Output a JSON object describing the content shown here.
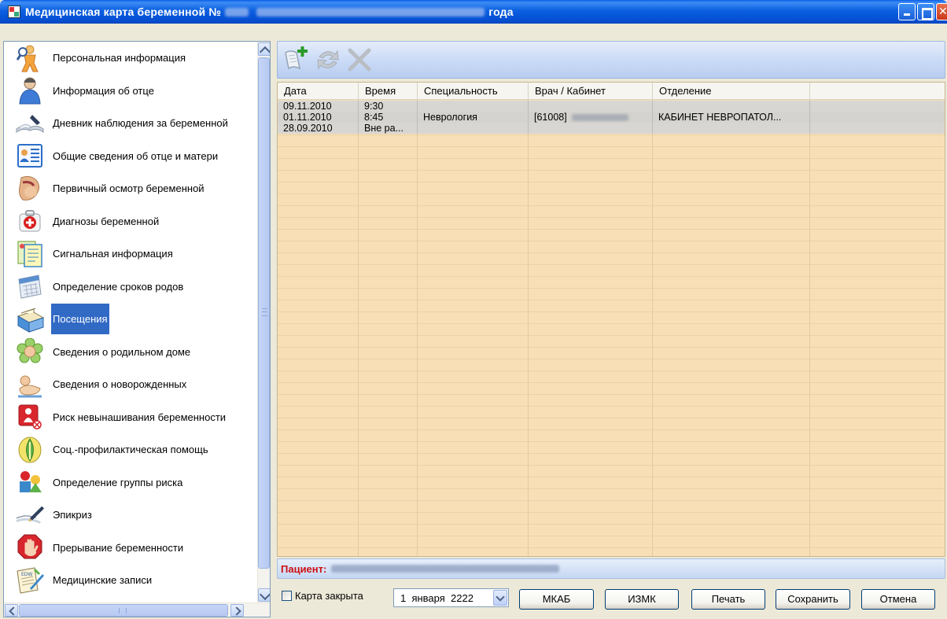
{
  "window": {
    "title_prefix": "Медицинская карта беременной №",
    "title_suffix": "года"
  },
  "sidebar": {
    "items": [
      {
        "label": "Персональная информация",
        "icon": "person-info-icon"
      },
      {
        "label": "Информация об отце",
        "icon": "father-icon"
      },
      {
        "label": "Дневник наблюдения за беременной",
        "icon": "diary-icon"
      },
      {
        "label": "Общие сведения об отце и матери",
        "icon": "parents-card-icon"
      },
      {
        "label": "Первичный осмотр беременной",
        "icon": "pregnant-exam-icon"
      },
      {
        "label": "Диагнозы беременной",
        "icon": "medkit-icon"
      },
      {
        "label": "Сигнальная информация",
        "icon": "signal-info-icon"
      },
      {
        "label": "Определение сроков родов",
        "icon": "calendar-icon"
      },
      {
        "label": "Посещения",
        "icon": "card-file-icon",
        "selected": true
      },
      {
        "label": "Сведения о родильном доме",
        "icon": "baby-flower-icon"
      },
      {
        "label": "Сведения о новорожденных",
        "icon": "newborn-icon"
      },
      {
        "label": "Риск невынашивания беременности",
        "icon": "risk-icon"
      },
      {
        "label": "Соц.-профилактическая помощь",
        "icon": "social-help-icon"
      },
      {
        "label": "Определение группы риска",
        "icon": "risk-group-icon"
      },
      {
        "label": "Эпикриз",
        "icon": "pen-icon"
      },
      {
        "label": "Прерывание беременности",
        "icon": "stop-hand-icon"
      },
      {
        "label": "Медицинские записи",
        "icon": "med-records-icon"
      }
    ]
  },
  "toolbar": {
    "buttons": [
      {
        "name": "add-visit-button",
        "icon": "add-document-icon"
      },
      {
        "name": "refresh-button",
        "icon": "refresh-icon"
      },
      {
        "name": "delete-button",
        "icon": "delete-x-icon"
      }
    ]
  },
  "visits": {
    "columns": [
      "Дата",
      "Время",
      "Специальность",
      "Врач / Кабинет",
      "Отделение"
    ],
    "rows": [
      {
        "date": "09.11.2010",
        "time": "9:30",
        "specialty": "",
        "doctor": "",
        "department": ""
      },
      {
        "date": "01.11.2010",
        "time": "8:45",
        "specialty": "Неврология",
        "doctor": "[61008]",
        "department": "КАБИНЕТ НЕВРОПАТОЛ..."
      },
      {
        "date": "28.09.2010",
        "time": "Вне ра...",
        "specialty": "",
        "doctor": "",
        "department": ""
      }
    ]
  },
  "patient": {
    "label": "Пациент:"
  },
  "footer": {
    "closed_label": "Карта закрыта",
    "closed_checked": false,
    "date_value": "1  января  2222",
    "mkab_label": "МКАБ",
    "izmk_label": "ИЗМК",
    "print_label": "Печать",
    "save_label": "Сохранить",
    "cancel_label": "Отмена"
  },
  "colors": {
    "title_bar": "#0551d6",
    "grid_background": "#f8dfb6",
    "selection": "#316ac5",
    "patient_label": "#cc1111"
  }
}
